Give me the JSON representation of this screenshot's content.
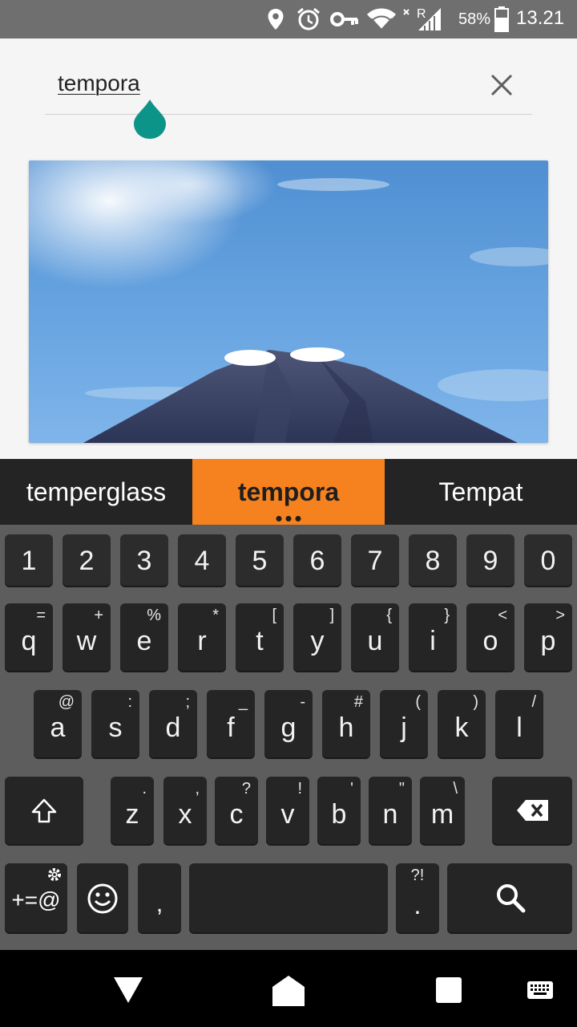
{
  "status_bar": {
    "icons": [
      "location-pin-icon",
      "alarm-clock-icon",
      "vpn-key-icon",
      "wifi-icon",
      "signal-roaming-icon",
      "battery-icon"
    ],
    "network_label": "R",
    "battery": "58%",
    "time": "13.21"
  },
  "search": {
    "query": "tempora",
    "clear_icon": "close-icon"
  },
  "image": {
    "subject": "volcano-photo"
  },
  "suggestions": [
    {
      "label": "temperglass",
      "active": false
    },
    {
      "label": "tempora",
      "active": true
    },
    {
      "label": "Tempat",
      "active": false
    }
  ],
  "keyboard": {
    "row_numbers": [
      "1",
      "2",
      "3",
      "4",
      "5",
      "6",
      "7",
      "8",
      "9",
      "0"
    ],
    "row1": [
      {
        "key": "q",
        "alt": "="
      },
      {
        "key": "w",
        "alt": "+"
      },
      {
        "key": "e",
        "alt": "%"
      },
      {
        "key": "r",
        "alt": "*"
      },
      {
        "key": "t",
        "alt": "["
      },
      {
        "key": "y",
        "alt": "]"
      },
      {
        "key": "u",
        "alt": "{"
      },
      {
        "key": "i",
        "alt": "}"
      },
      {
        "key": "o",
        "alt": "<"
      },
      {
        "key": "p",
        "alt": ">"
      }
    ],
    "row2": [
      {
        "key": "a",
        "alt": "@"
      },
      {
        "key": "s",
        "alt": ":"
      },
      {
        "key": "d",
        "alt": ";"
      },
      {
        "key": "f",
        "alt": "_"
      },
      {
        "key": "g",
        "alt": "-"
      },
      {
        "key": "h",
        "alt": "#"
      },
      {
        "key": "j",
        "alt": "("
      },
      {
        "key": "k",
        "alt": ")"
      },
      {
        "key": "l",
        "alt": "/"
      }
    ],
    "row3": [
      {
        "key": "z",
        "alt": "."
      },
      {
        "key": "x",
        "alt": ","
      },
      {
        "key": "c",
        "alt": "?"
      },
      {
        "key": "v",
        "alt": "!"
      },
      {
        "key": "b",
        "alt": "'"
      },
      {
        "key": "n",
        "alt": "\""
      },
      {
        "key": "m",
        "alt": "\\"
      }
    ],
    "symbols_label": "+=@",
    "comma": ",",
    "period": ".",
    "period_alt": "?!"
  },
  "colors": {
    "accent_orange": "#f5821f",
    "handle_teal": "#0d9488",
    "key_bg": "#2c2c2c",
    "keyboard_bg": "#5d5d5d"
  }
}
